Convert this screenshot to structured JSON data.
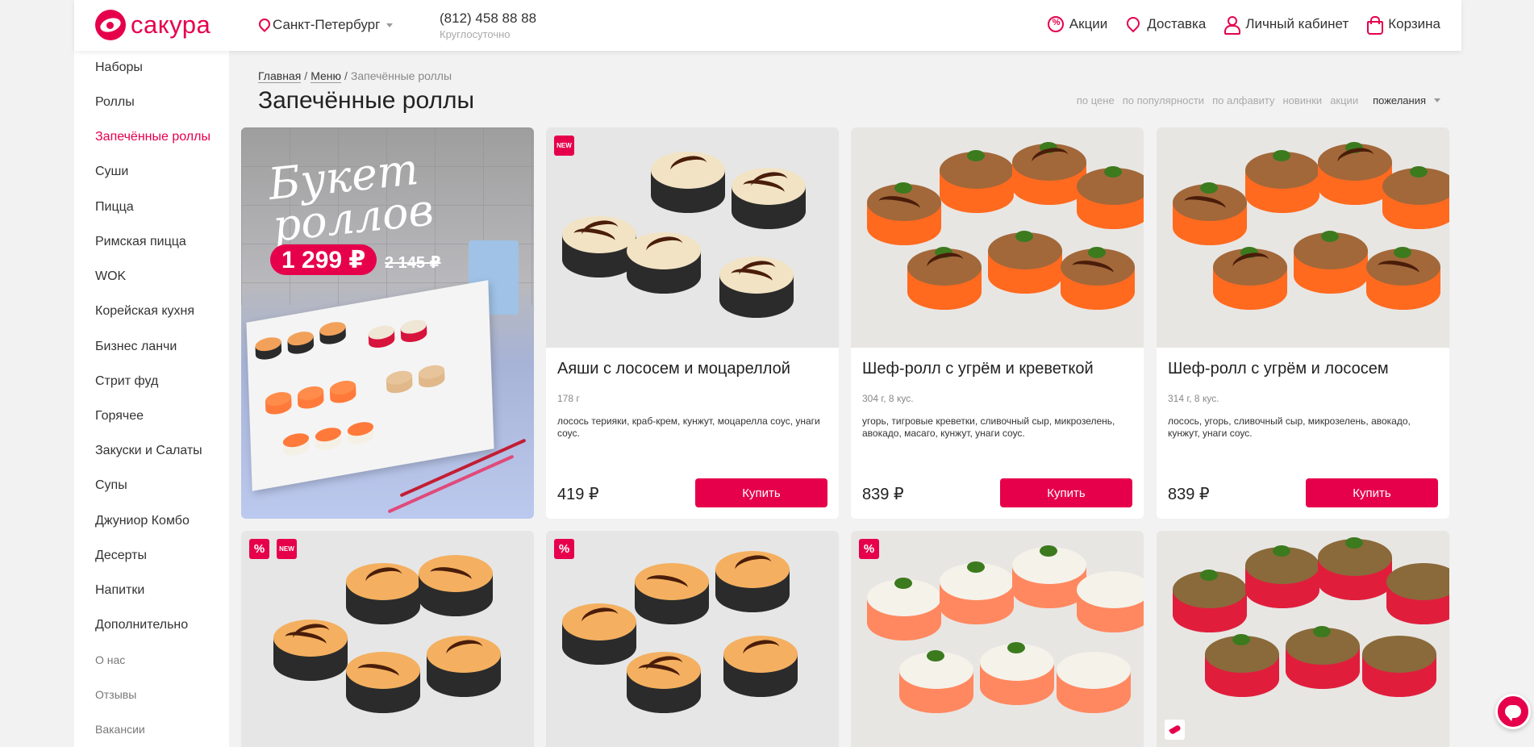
{
  "header": {
    "logo_text": "сакура",
    "city": "Санкт-Петербург",
    "phone": "(812) 458 88 88",
    "phone_note": "Круглосуточно",
    "nav": [
      {
        "label": "Акции",
        "icon": "promo-icon"
      },
      {
        "label": "Доставка",
        "icon": "delivery-icon"
      },
      {
        "label": "Личный кабинет",
        "icon": "user-icon"
      },
      {
        "label": "Корзина",
        "icon": "cart-icon"
      }
    ]
  },
  "sidebar": {
    "items": [
      "Наборы",
      "Роллы",
      "Запечённые роллы",
      "Суши",
      "Пицца",
      "Римская пицца",
      "WOK",
      "Корейская кухня",
      "Бизнес ланчи",
      "Стрит фуд",
      "Горячее",
      "Закуски и Салаты",
      "Супы",
      "Джуниор Комбо",
      "Десерты",
      "Напитки",
      "Дополнительно"
    ],
    "active": "Запечённые роллы",
    "minor_items": [
      "О нас",
      "Отзывы",
      "Вакансии"
    ]
  },
  "breadcrumb": {
    "home": "Главная",
    "menu": "Меню",
    "separator": "/",
    "current": "Запечённые роллы"
  },
  "page_title": "Запечённые роллы",
  "sort": {
    "options": [
      "по цене",
      "по популярности",
      "по алфавиту",
      "новинки",
      "акции"
    ],
    "selected": "пожелания"
  },
  "promo_banner": {
    "headline": "Букет роллов",
    "price": "1 299 ₽",
    "old_price": "2 145 ₽"
  },
  "products": [
    {
      "title": "Аяши с лососем и моцареллой",
      "weight": "178 г",
      "description": "лосось терияки, краб-крем, кунжут, моцарелла соус, унаги соус.",
      "price": "419 ₽",
      "badges": [
        "NEW"
      ]
    },
    {
      "title": "Шеф-ролл с угрём и креветкой",
      "weight": "304 г, 8 кус.",
      "description": "угорь, тигровые креветки, сливочный сыр, микрозелень, авокадо, масаго, кунжут, унаги соус.",
      "price": "839 ₽",
      "badges": []
    },
    {
      "title": "Шеф-ролл с угрём и лососем",
      "weight": "314 г, 8 кус.",
      "description": "лосось, угорь, сливочный сыр, микрозелень, авокадо, кунжут, унаги соус.",
      "price": "839 ₽",
      "badges": []
    }
  ],
  "buy_label": "Купить",
  "second_row_badges": [
    [
      "%",
      "NEW"
    ],
    [
      "%"
    ],
    [
      "%"
    ],
    [
      "chili-icon"
    ]
  ],
  "colors": {
    "accent": "#e6004c",
    "background": "#f2f2f2"
  }
}
